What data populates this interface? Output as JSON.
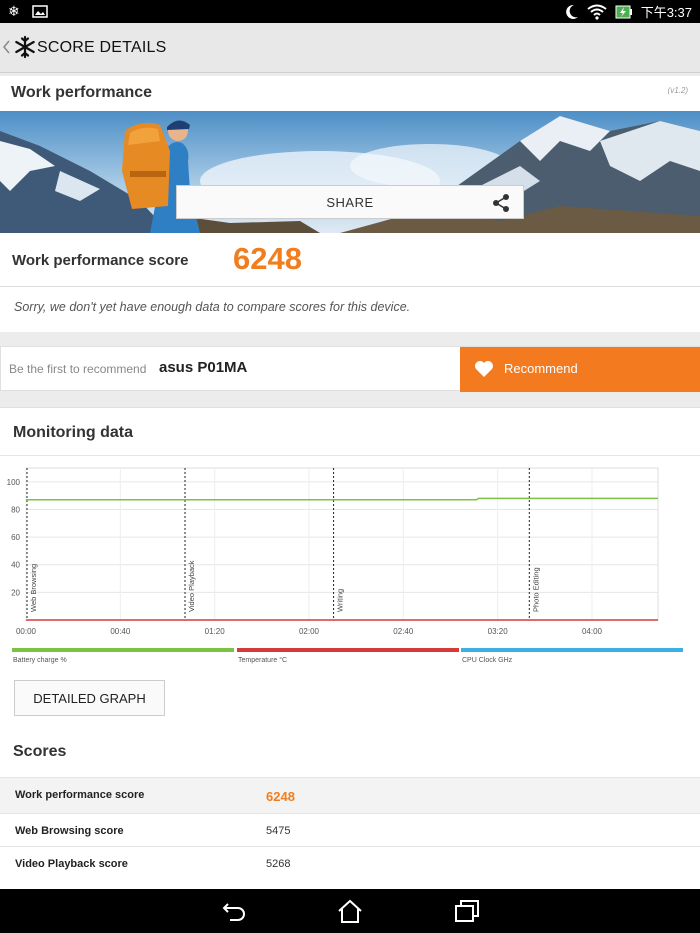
{
  "status_bar": {
    "time": "下午3:37",
    "icons": [
      "snowflake-icon",
      "image-icon",
      "moon-icon",
      "wifi-icon",
      "battery-charging-icon"
    ]
  },
  "action_bar": {
    "title": "SCORE DETAILS",
    "back_icon": "chevron-left-icon",
    "logo_icon": "snowflake-logo-icon"
  },
  "work_card": {
    "title": "Work performance",
    "version": "(v1.2)",
    "share_label": "SHARE",
    "share_icon": "share-icon",
    "score_label": "Work performance score",
    "score_value": "6248",
    "sorry_text": "Sorry, we don't yet have enough data to compare scores for this device."
  },
  "recommend": {
    "text": "Be the first to recommend",
    "device": "asus P01MA",
    "button_label": "Recommend",
    "button_icon": "heart-icon"
  },
  "monitoring": {
    "title": "Monitoring data",
    "detailed_button": "DETAILED GRAPH",
    "legend": [
      {
        "label": "Battery charge %",
        "color": "#7cc243"
      },
      {
        "label": "Temperature °C",
        "color": "#d63a3a"
      },
      {
        "label": "CPU Clock GHz",
        "color": "#3db0e3"
      }
    ]
  },
  "chart_data": {
    "type": "line",
    "y_ticks": [
      "100",
      "80",
      "60",
      "40",
      "20"
    ],
    "x_ticks": [
      "00:00",
      "00:40",
      "01:20",
      "02:00",
      "02:40",
      "03:20",
      "04:00"
    ],
    "ylim": [
      0,
      110
    ],
    "xlim_minutes": [
      0,
      268
    ],
    "markers": [
      {
        "label": "Web Browsing",
        "x_min": 0
      },
      {
        "label": "Video Playback",
        "x_min": 67
      },
      {
        "label": "Writing",
        "x_min": 130
      },
      {
        "label": "Photo Editing",
        "x_min": 213
      }
    ],
    "series": [
      {
        "name": "Battery charge %",
        "color": "#7cc243",
        "points": [
          [
            0,
            87
          ],
          [
            191,
            87
          ],
          [
            192,
            88
          ],
          [
            268,
            88
          ]
        ]
      },
      {
        "name": "Temperature °C",
        "color": "#d63a3a",
        "points": [
          [
            0,
            0
          ],
          [
            268,
            0
          ]
        ]
      }
    ]
  },
  "scores": {
    "title": "Scores",
    "rows": [
      {
        "label": "Work performance score",
        "value": "6248"
      },
      {
        "label": "Web Browsing score",
        "value": "5475"
      },
      {
        "label": "Video Playback score",
        "value": "5268"
      }
    ]
  },
  "nav_bar": {
    "icons": [
      "back-icon",
      "home-icon",
      "recent-apps-icon"
    ]
  }
}
